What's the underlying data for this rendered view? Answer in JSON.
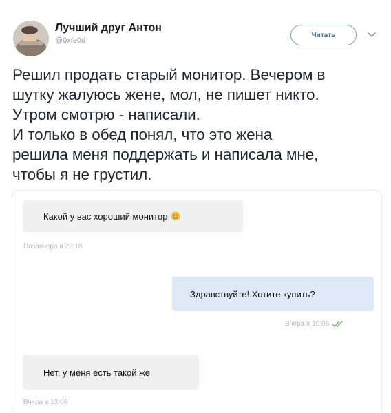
{
  "author": {
    "name": "Лучший друг Антон",
    "handle": "@0xfe0d",
    "follow_label": "Читать"
  },
  "tweet": {
    "lines": [
      "Решил продать старый монитор. Вечером в",
      "шутку жалуюсь жене, мол, не пишет никто.",
      "Утром смотрю - написали.",
      "И только в обед понял, что это жена",
      "решила меня поддержать и написала мне,",
      "чтобы я не грустил."
    ]
  },
  "chat": {
    "messages": [
      {
        "text": "Какой у вас хороший монитор",
        "emoji": "smiling-heart-eyes-emoji",
        "time": "Позавчера в 23:18",
        "direction": "incoming"
      },
      {
        "text": "Здравствуйте! Хотите купить?",
        "time": "Вчера в 10:06",
        "status": "read-double-check",
        "direction": "outgoing"
      },
      {
        "text": "Нет, у меня есть такой же",
        "time": "Вчера в 13:06",
        "direction": "incoming"
      }
    ]
  },
  "colors": {
    "follow_border": "#7c9fc4",
    "follow_text": "#3f6a97",
    "incoming_bubble": "#eef0f2",
    "outgoing_bubble": "#dde9f6",
    "read_check": "#5eb95e",
    "timestamp": "#b6bcc4"
  }
}
